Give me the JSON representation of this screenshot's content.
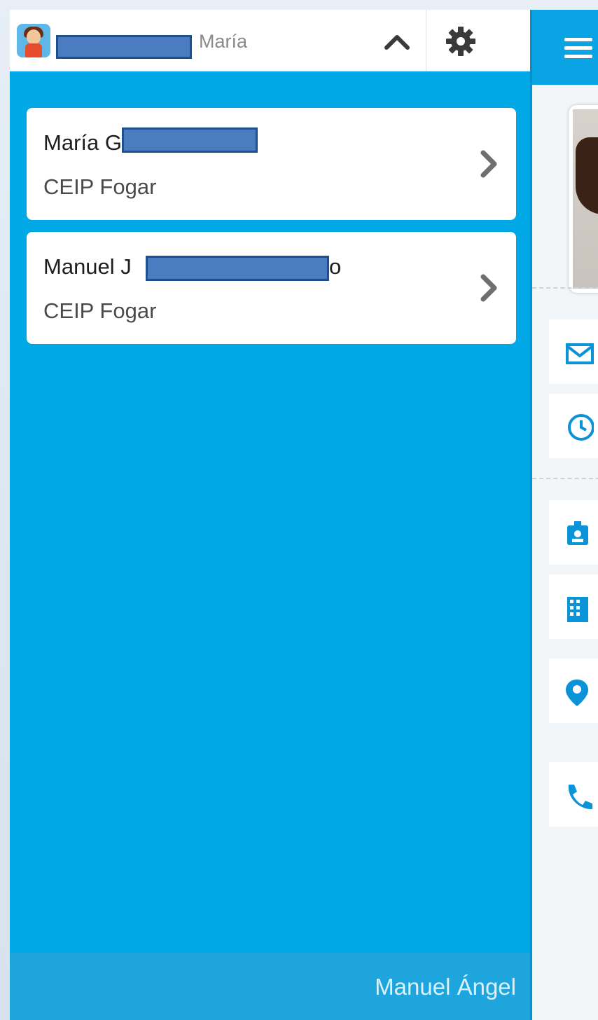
{
  "account": {
    "name_visible": "María",
    "collapse_icon": "chevron-up-icon",
    "settings_icon": "gear-icon"
  },
  "students": [
    {
      "name": "María G",
      "school": "CEIP Fogar"
    },
    {
      "name": "Manuel J",
      "name_tail": "o",
      "school": "CEIP Fogar"
    }
  ],
  "footer": {
    "user": "Manuel Ángel"
  },
  "background_nav": {
    "menu_icon": "hamburger-icon",
    "icons": [
      "mail-icon",
      "clock-icon",
      "id-badge-icon",
      "building-icon",
      "location-pin-icon",
      "phone-icon"
    ]
  },
  "colors": {
    "drawer_bg": "#00a8e6",
    "header_bg": "#ffffff",
    "footer_bg": "#1ea5de",
    "accent": "#0aa4e4",
    "redaction": "#4a7cc2"
  }
}
